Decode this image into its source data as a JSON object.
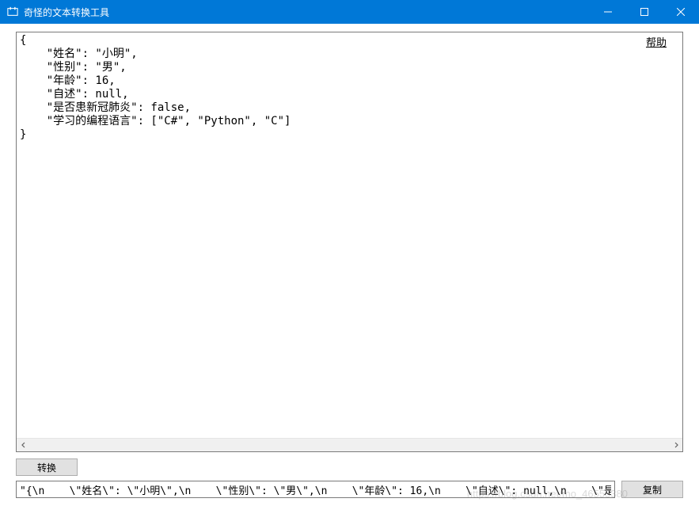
{
  "window": {
    "title": "奇怪的文本转换工具"
  },
  "help": {
    "label": "帮助"
  },
  "main_text": "{\n    \"姓名\": \"小明\",\n    \"性别\": \"男\",\n    \"年龄\": 16,\n    \"自述\": null,\n    \"是否患新冠肺炎\": false,\n    \"学习的编程语言\": [\"C#\", \"Python\", \"C\"]\n}",
  "buttons": {
    "convert": "转换",
    "copy": "复制"
  },
  "output": {
    "value": "\"{\\n    \\\"姓名\\\": \\\"小明\\\",\\n    \\\"性别\\\": \\\"男\\\",\\n    \\\"年龄\\\": 16,\\n    \\\"自述\\\": null,\\n    \\\"是否患新冠肺炎\\\": false,\\n"
  },
  "watermark": "https://blog.csdn.net/mo_46555380"
}
